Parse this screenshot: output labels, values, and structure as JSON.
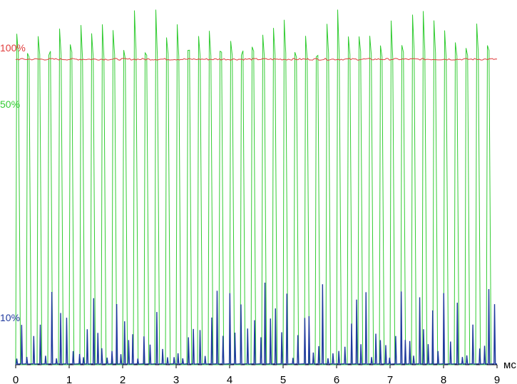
{
  "chart_data": {
    "type": "line",
    "x_unit": "мс",
    "x_ticks": [
      "0",
      "1",
      "2",
      "3",
      "4",
      "5",
      "6",
      "7",
      "8",
      "9"
    ],
    "xlim": [
      0,
      9
    ],
    "series": [
      {
        "name": "100%",
        "color": "#e03c3c",
        "level": 100,
        "description": "flat level with slight noise"
      },
      {
        "name": "50%",
        "color": "#33cc33",
        "level": 50,
        "pulse_count": 45,
        "pulse_period_ms": 0.2,
        "baseline": 0,
        "peak_range": [
          100,
          117
        ]
      },
      {
        "name": "10%",
        "color": "#1f3a9e",
        "level": 10,
        "pulse_period_ms": 0.1,
        "baseline": 0,
        "peak_range": [
          2,
          28
        ]
      }
    ]
  }
}
